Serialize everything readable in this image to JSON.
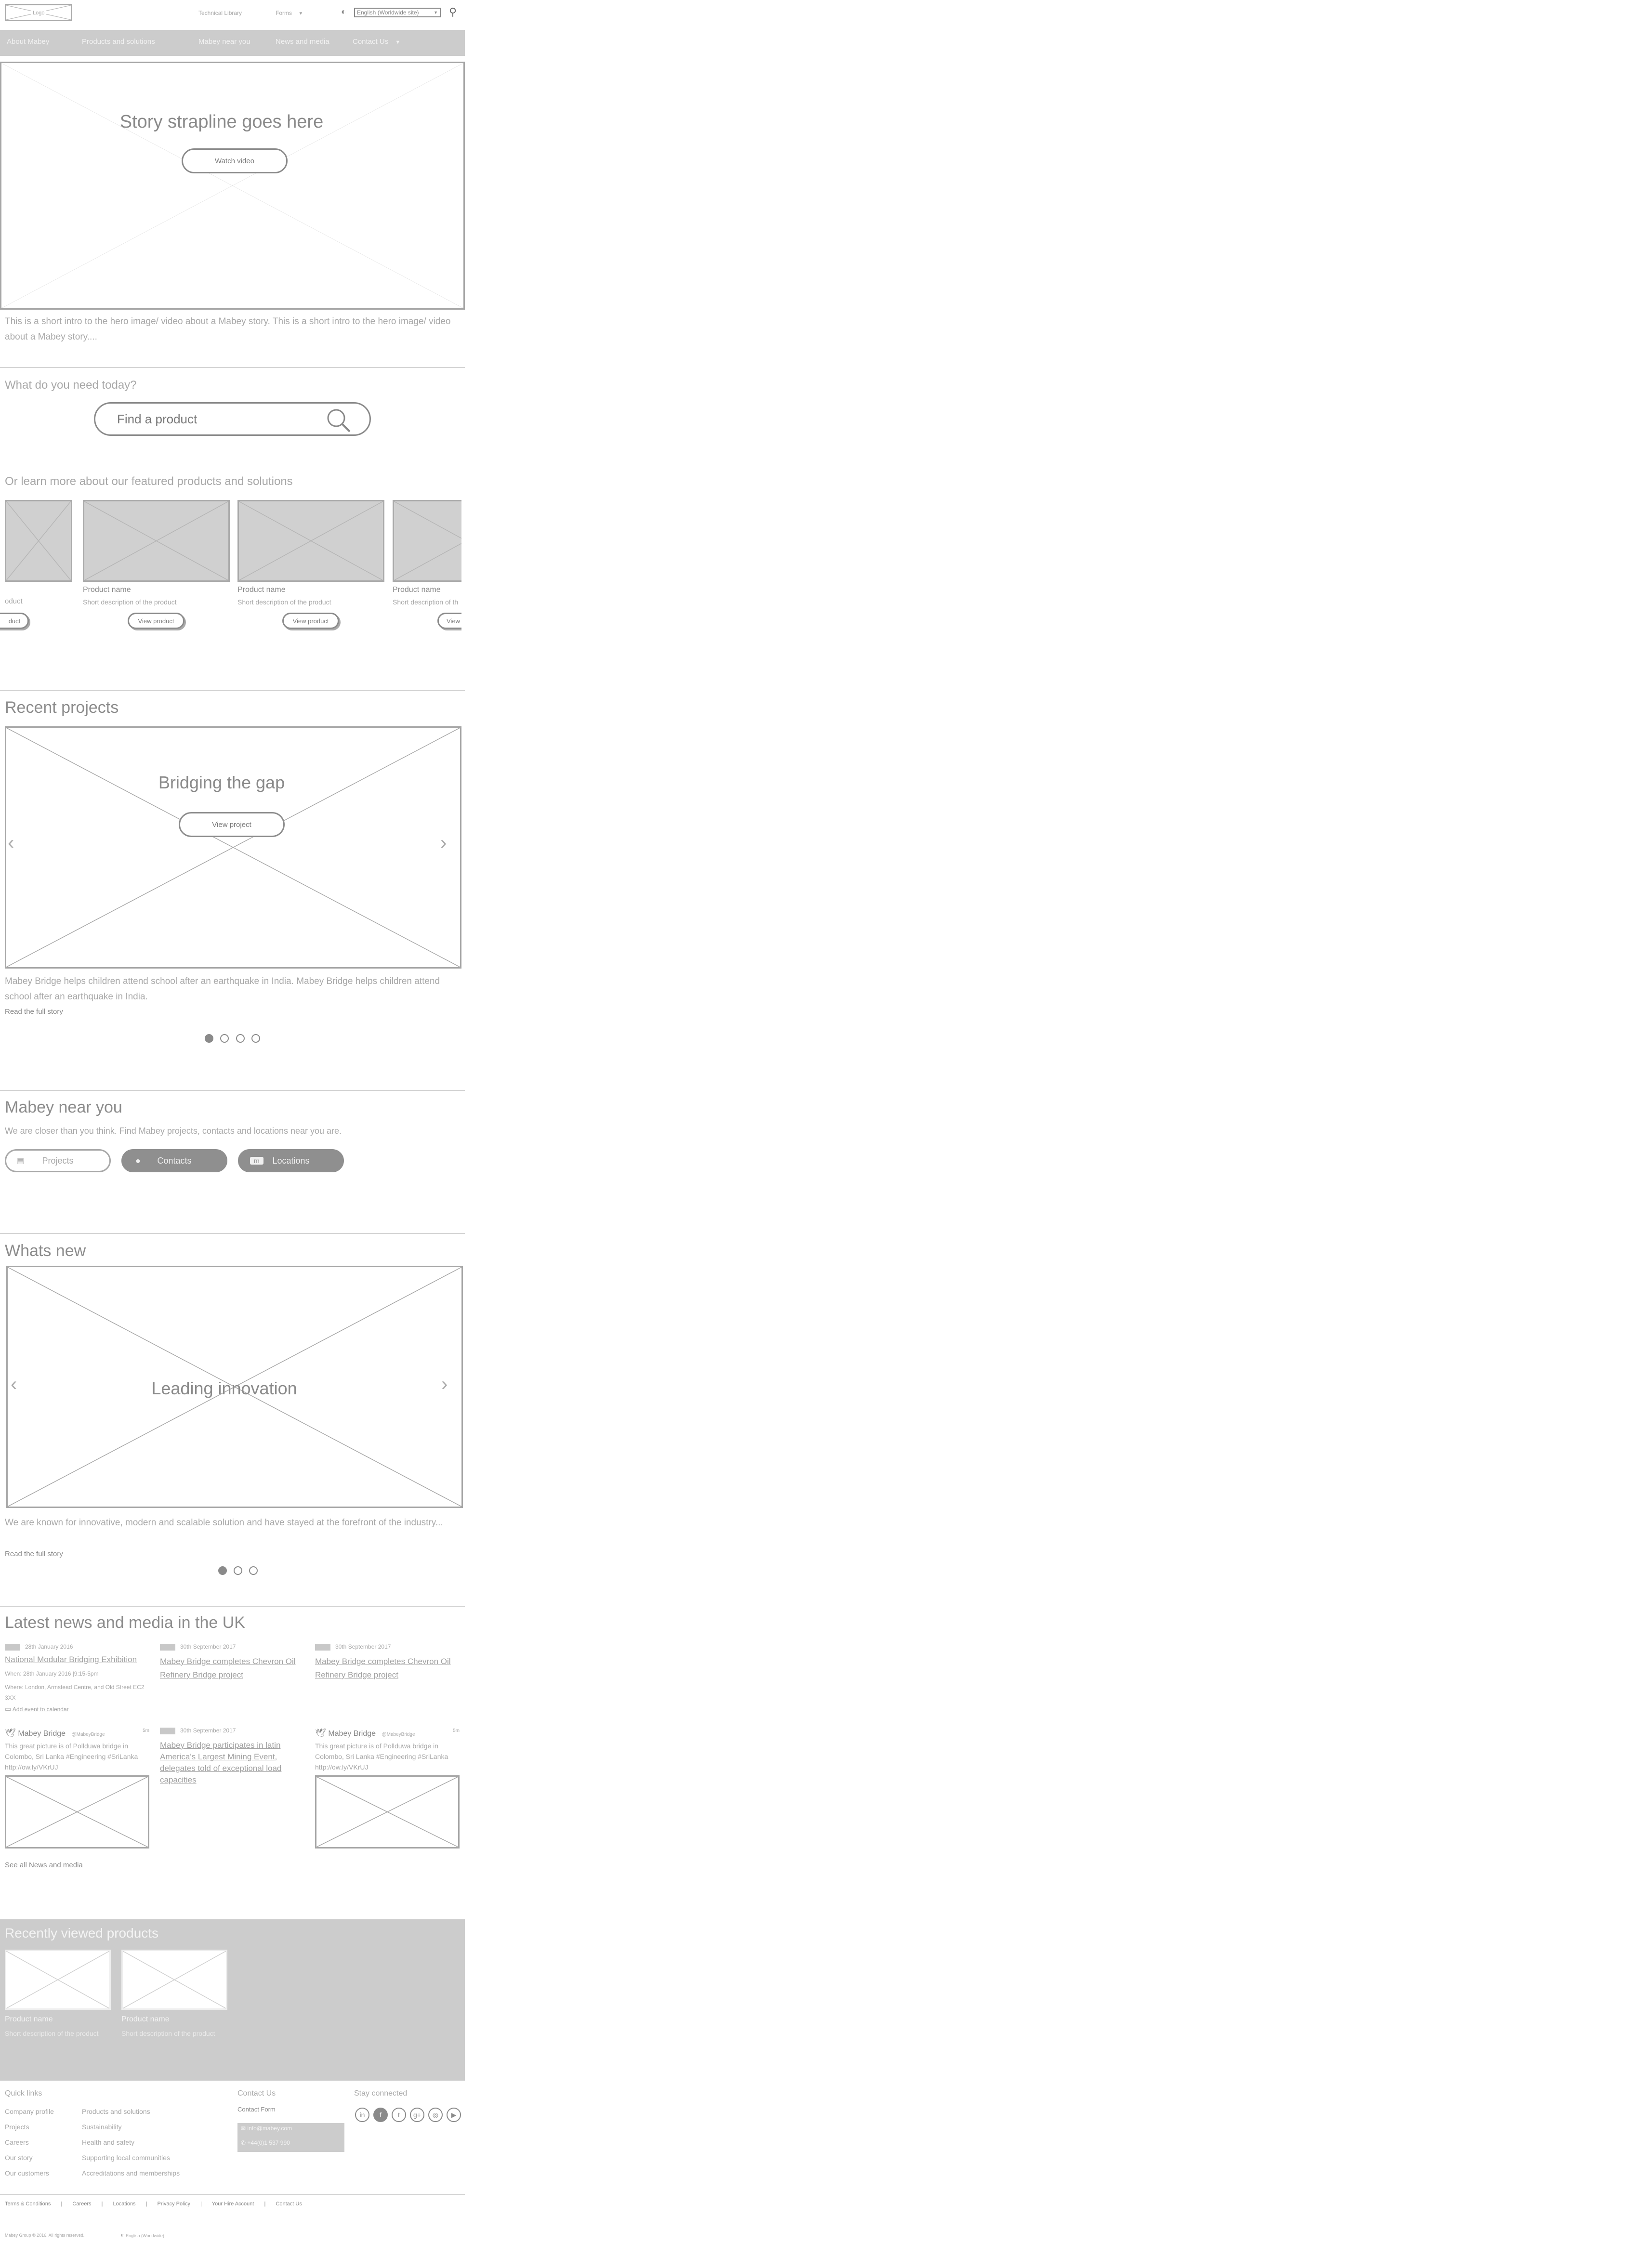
{
  "header": {
    "logo": "Logo",
    "technical_library": "Technical Library",
    "forms": "Forms",
    "language": "English (Worldwide site)"
  },
  "nav": [
    "About Mabey",
    "Products and solutions",
    "Mabey near you",
    "News and media",
    "Contact Us"
  ],
  "hero": {
    "strapline": "Story strapline goes here",
    "button": "Watch video",
    "intro": "This is a short intro to the hero image/ video about a Mabey story. This is a short intro to the hero image/ video about a Mabey story...."
  },
  "search": {
    "question": "What do you need today?",
    "placeholder": "Find a product"
  },
  "featured": {
    "heading": "Or learn more about our featured products and solutions",
    "partial_name": "oduct",
    "partial_button": "duct",
    "product_name": "Product name",
    "product_desc": "Short description of the product",
    "product_button": "View product",
    "cut_desc": "Short description of th",
    "cut_button": "View"
  },
  "projects": {
    "heading": "Recent projects",
    "slide_title": "Bridging the gap",
    "button": "View project",
    "text": "Mabey Bridge helps children attend school after an earthquake in India. Mabey Bridge helps children attend school after an earthquake in India.",
    "read_more": "Read the full story"
  },
  "near_you": {
    "heading": "Mabey near you",
    "text": "We are closer than you think. Find Mabey projects, contacts and locations near you are.",
    "buttons": [
      "Projects",
      "Contacts",
      "Locations"
    ]
  },
  "whats_new": {
    "heading": "Whats new",
    "slide_title": "Leading innovation",
    "text": "We are known for innovative, modern and scalable solution and have stayed at the forefront of the industry...",
    "read_more": "Read the full story"
  },
  "news": {
    "heading": "Latest news and media in the UK",
    "event_date": "28th January 2016",
    "event_title": "National Modular Bridging Exhibition",
    "event_when": "When: 28th January 2016 |9:15-5pm",
    "event_where": "Where: London, Armstead Centre, and Old Street EC2 3XX",
    "event_calendar": "Add event to calendar",
    "news_date": "30th September 2017",
    "news_title": "Mabey Bridge completes Chevron Oil Refinery Bridge project",
    "news2_date": "30th September 2017",
    "news2_title": "Mabey Bridge participates in latin America's Largest Mining Event, delegates told of exceptional load capacities",
    "tweet_user": "Mabey Bridge",
    "tweet_handle": "@MabeyBridge",
    "tweet_time": "5m",
    "tweet_text": "This great picture is of Pollduwa bridge in Colombo, Sri Lanka #Engineering #SriLanka http://ow.ly/VKrUJ",
    "see_all": "See all News and media"
  },
  "recent_viewed": {
    "heading": "Recently viewed products",
    "product_name": "Product name",
    "product_desc": "Short description of the product"
  },
  "footer": {
    "quick_links_title": "Quick links",
    "col1": [
      "Company profile",
      "Projects",
      "Careers",
      "Our story",
      "Our customers"
    ],
    "col2": [
      "Products and solutions",
      "Sustainability",
      "Health and safety",
      "Supporting local communities",
      "Accreditations and memberships"
    ],
    "contact_title": "Contact Us",
    "contact_form": "Contact Form",
    "email": "info@mabey.com",
    "phone": "+44(0)1 537 990",
    "stay_connected": "Stay connected",
    "social": [
      "in",
      "f",
      "t",
      "g+",
      "◎",
      "▶"
    ],
    "bottom_links": [
      "Terms & Conditions",
      "Careers",
      "Locations",
      "Privacy Policy",
      "Your Hire Account",
      "Contact Us"
    ],
    "copyright": "Mabey Group ® 2016. All rights reserved.",
    "language": "English (Worldwide)"
  }
}
